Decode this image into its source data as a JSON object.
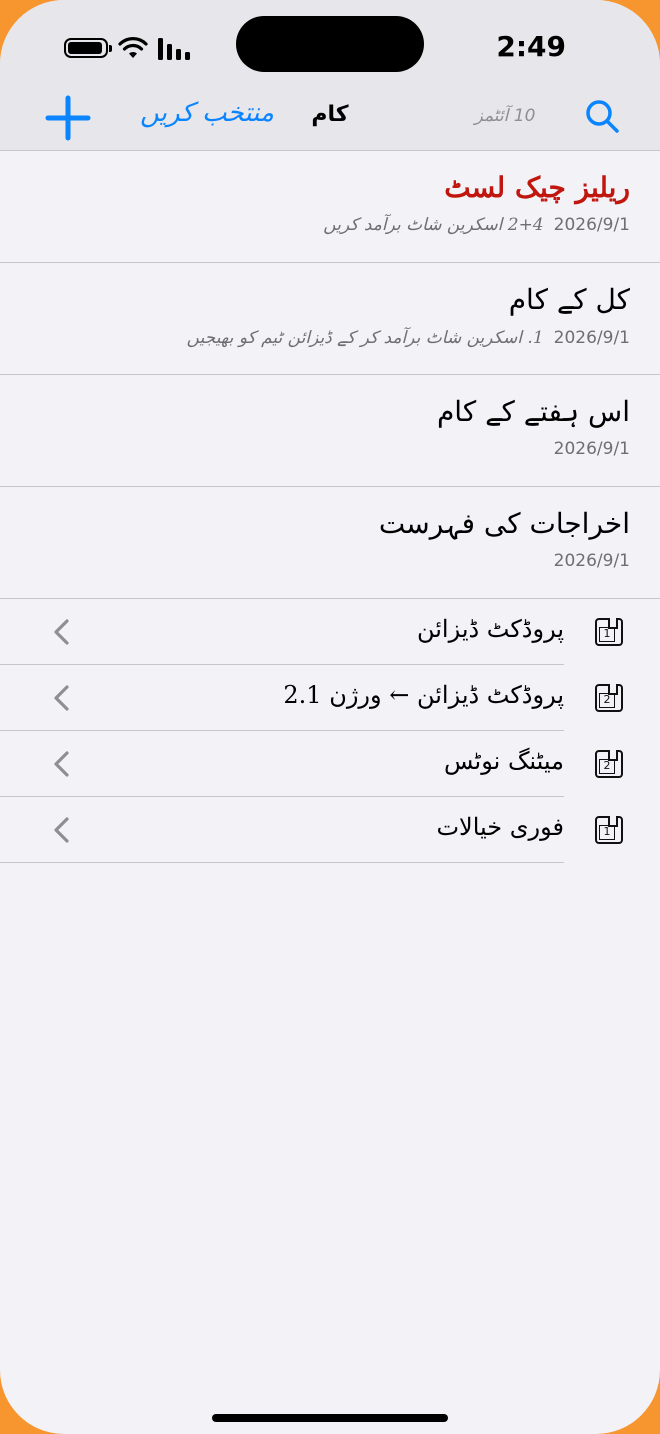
{
  "status_bar": {
    "time": "2:49",
    "icons": [
      "battery-icon",
      "wifi-icon",
      "signal-icon"
    ]
  },
  "nav": {
    "add_icon": "plus-icon",
    "select_label": "منتخب کریں",
    "title": "کام",
    "count_label": "10 آئٹمز",
    "search_icon": "search-icon"
  },
  "notes": [
    {
      "title": "ریلیز چیک لسٹ",
      "date": "2026/9/1",
      "preview": "2+4 اسکرین شاٹ برآمد کریں"
    },
    {
      "title": "کل کے کام",
      "date": "2026/9/1",
      "preview": "1. اسکرین شاٹ برآمد کر کے ڈیزائن ٹیم کو بھیجیں"
    },
    {
      "title": "اس ہفتے کے کام",
      "date": "2026/9/1",
      "preview": ""
    },
    {
      "title": "اخراجات کی فہرست",
      "date": "2026/9/1",
      "preview": ""
    }
  ],
  "folders": [
    {
      "label": "پروڈکٹ ڈیزائن",
      "badge": "1"
    },
    {
      "label": "پروڈکٹ ڈیزائن ← ورژن 2.1",
      "badge": "2"
    },
    {
      "label": "میٹنگ نوٹس",
      "badge": "2"
    },
    {
      "label": "فوری خیالات",
      "badge": "1"
    }
  ],
  "colors": {
    "accent": "#0A84FF",
    "highlight_title": "#C0160E",
    "background": "#F2F2F7",
    "frame": "#F7952E"
  }
}
